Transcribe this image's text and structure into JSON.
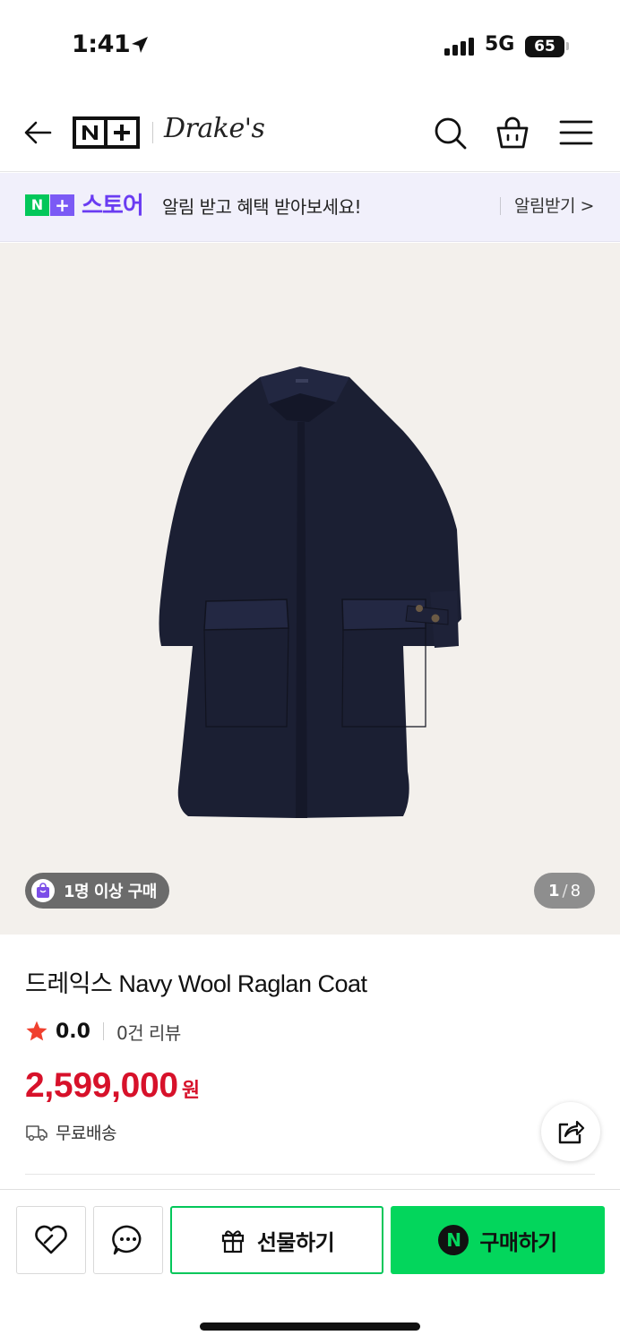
{
  "status_bar": {
    "time": "1:41",
    "network": "5G",
    "battery": "65"
  },
  "header": {
    "platform_logo": "N+",
    "brand_logo": "Drake's"
  },
  "notice": {
    "badge_n": "N",
    "badge_plus": "+",
    "store_label": "스토어",
    "message": "알림 받고 혜택 받아보세요!",
    "link_label": "알림받기 >"
  },
  "gallery": {
    "purchase_badge": "1명 이상 구매",
    "current_page": "1",
    "separator": "/",
    "total_pages": "8"
  },
  "product": {
    "title": "드레익스 Navy Wool Raglan Coat",
    "rating": "0.0",
    "review_count": "0건 리뷰",
    "price": "2,599,000",
    "currency": "원",
    "shipping": "무료배송"
  },
  "bottom_bar": {
    "gift_label": "선물하기",
    "buy_label": "구매하기",
    "npay_symbol": "N"
  },
  "colors": {
    "accent_green": "#03c75a",
    "store_purple": "#6a3cf2",
    "price_red": "#d7112a",
    "banner_bg": "#f1f0fb"
  }
}
